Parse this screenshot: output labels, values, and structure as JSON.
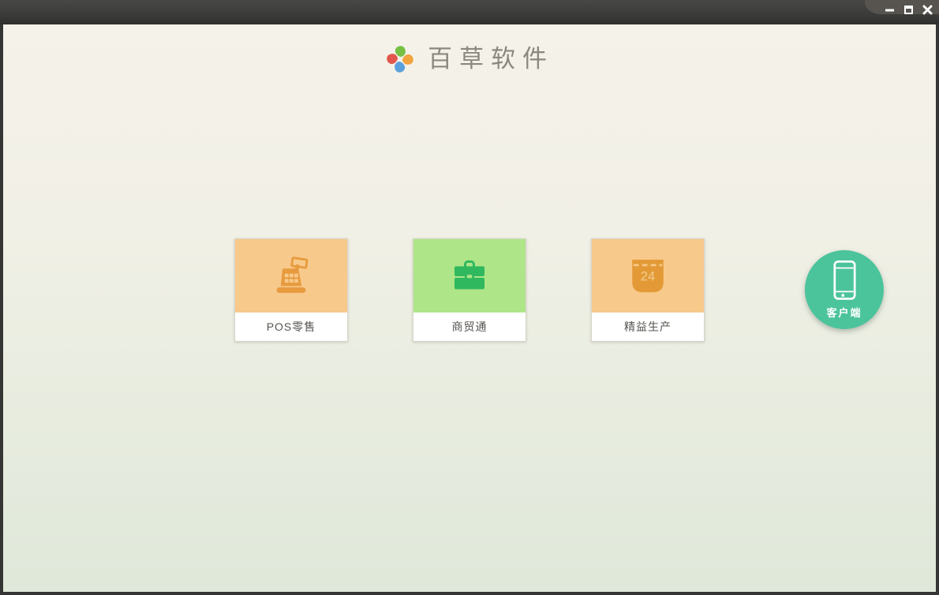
{
  "window": {
    "controls": {
      "minimize": "minimize-icon",
      "maximize": "maximize-icon",
      "close": "close-icon"
    }
  },
  "header": {
    "app_name": "百草软件",
    "logo": "pinwheel-icon",
    "logo_colors": {
      "top": "#76c043",
      "right": "#f1a33c",
      "bottom": "#5aa0dd",
      "left": "#e2574d"
    }
  },
  "products": [
    {
      "label": "POS零售",
      "icon": "cash-register-icon",
      "panel_color": "#f7c98b",
      "icon_color": "#e79b3e"
    },
    {
      "label": "商贸通",
      "icon": "briefcase-icon",
      "panel_color": "#aee588",
      "icon_color": "#2fb85e"
    },
    {
      "label": "精益生产",
      "icon": "calendar-icon",
      "day": "24",
      "panel_color": "#f7c98b",
      "icon_color": "#e39a36"
    }
  ],
  "client_button": {
    "label": "客户端",
    "icon": "smartphone-icon",
    "color": "#4cc49b"
  },
  "theme": {
    "titlebar_color": "#3c3c3a",
    "corner_tab_color": "#57544f",
    "background_top": "#f5f2e9",
    "background_bottom": "#dfe8da",
    "title_text_color": "#8a887f",
    "card_label_color": "#56544f"
  }
}
